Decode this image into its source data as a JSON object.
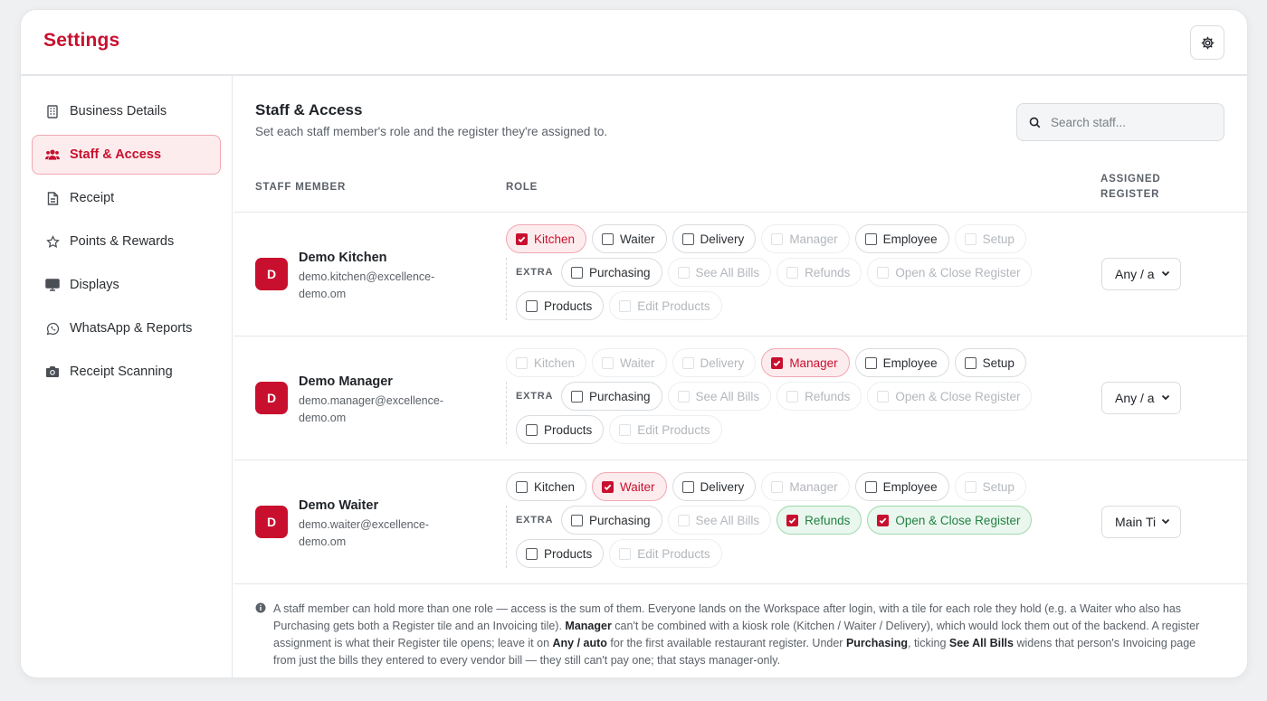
{
  "header": {
    "title": "Settings"
  },
  "sidebar": {
    "items": [
      {
        "label": "Business Details",
        "icon": "building-icon",
        "active": false
      },
      {
        "label": "Staff & Access",
        "icon": "users-icon",
        "active": true
      },
      {
        "label": "Receipt",
        "icon": "receipt-icon",
        "active": false
      },
      {
        "label": "Points & Rewards",
        "icon": "star-icon",
        "active": false
      },
      {
        "label": "Displays",
        "icon": "monitor-icon",
        "active": false
      },
      {
        "label": "WhatsApp & Reports",
        "icon": "whatsapp-icon",
        "active": false
      },
      {
        "label": "Receipt Scanning",
        "icon": "camera-icon",
        "active": false
      }
    ]
  },
  "main": {
    "title": "Staff & Access",
    "subtitle": "Set each staff member's role and the register they're assigned to.",
    "search_placeholder": "Search staff...",
    "columns": {
      "member": "STAFF MEMBER",
      "role": "ROLE",
      "register_1": "ASSIGNED",
      "register_2": "REGISTER"
    },
    "extra_label": "EXTRA",
    "staff": [
      {
        "initial": "D",
        "name": "Demo Kitchen",
        "email": "demo.kitchen@excellence-demo.om",
        "register": "Any / a",
        "roles": {
          "Kitchen": "on",
          "Waiter": "off",
          "Delivery": "off",
          "Manager": "disabled",
          "Employee": "off",
          "Setup": "disabled"
        },
        "extras": {
          "Purchasing": "off",
          "See All Bills": "disabled",
          "Refunds": "disabled",
          "Open & Close Register": "disabled",
          "Products": "off",
          "Edit Products": "disabled"
        }
      },
      {
        "initial": "D",
        "name": "Demo Manager",
        "email": "demo.manager@excellence-demo.om",
        "register": "Any / a",
        "roles": {
          "Kitchen": "disabled",
          "Waiter": "disabled",
          "Delivery": "disabled",
          "Manager": "on",
          "Employee": "off",
          "Setup": "off"
        },
        "extras": {
          "Purchasing": "off",
          "See All Bills": "disabled",
          "Refunds": "disabled",
          "Open & Close Register": "disabled",
          "Products": "off",
          "Edit Products": "disabled"
        }
      },
      {
        "initial": "D",
        "name": "Demo Waiter",
        "email": "demo.waiter@excellence-demo.om",
        "register": "Main Ti",
        "roles": {
          "Kitchen": "off",
          "Waiter": "on",
          "Delivery": "off",
          "Manager": "disabled",
          "Employee": "off",
          "Setup": "disabled"
        },
        "extras": {
          "Purchasing": "off",
          "See All Bills": "disabled",
          "Refunds": "green",
          "Open & Close Register": "green",
          "Products": "off",
          "Edit Products": "disabled"
        }
      }
    ],
    "note": {
      "t1": "A staff member can hold more than one role — access is the sum of them. Everyone lands on the Workspace after login, with a tile for each role they hold (e.g. a Waiter who also has Purchasing gets both a Register tile and an Invoicing tile). ",
      "b1": "Manager",
      "t2": " can't be combined with a kiosk role (Kitchen / Waiter / Delivery), which would lock them out of the backend. A register assignment is what their Register tile opens; leave it on ",
      "b2": "Any / auto",
      "t3": " for the first available restaurant register. Under ",
      "b3": "Purchasing",
      "t4": ", ticking ",
      "b4": "See All Bills",
      "t5": " widens that person's Invoicing page from just the bills they entered to every vendor bill — they still can't pay one; that stays manager-only."
    }
  },
  "colors": {
    "brand": "#c8102e",
    "success": "#238043"
  }
}
